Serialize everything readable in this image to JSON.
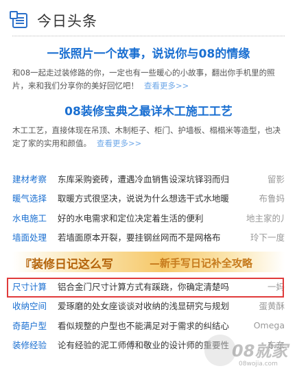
{
  "header": {
    "title": "今日头条"
  },
  "features": [
    {
      "headline": "一张照片一个故事，说说你与08的情缘",
      "desc": "和08一起走过装修路的你，一定也有一些暖心的小故事，翻出你手机里的照片，来和我们分享你的美好回忆吧！",
      "more": "查看更多>>"
    },
    {
      "headline": "08装修宝典之最详木工施工工艺",
      "desc": "木工工艺，直接体现在吊顶、木制柜子、柜门、护墙板、榻榻米等造型，也决定了家的实用和颜值。",
      "more": "查看更多>>"
    }
  ],
  "list_top": [
    {
      "cat": "建材考察",
      "text": "东库采购瓷砖，遭遇冷血销售设深坑铎羽而归",
      "author": "留影"
    },
    {
      "cat": "暖气选择",
      "text": "取暖方式很坚决，说说为什么想选干式水地暖",
      "author": "布鲁妈"
    },
    {
      "cat": "水电施工",
      "text": "好的水电需求和定位决定着生活的便利",
      "author": "地主家的儿子"
    },
    {
      "cat": "墙面处理",
      "text": "若墙面原本开裂，要挂钢丝网而不是网格布",
      "author": "玲下一度"
    }
  ],
  "banner": {
    "main": "装修日记这么写",
    "sub": "—新手写日记补全攻略"
  },
  "list_bottom": [
    {
      "cat": "尺寸计算",
      "text": "铝合金门尺寸计算方式有蹊跷，你确定清楚吗",
      "author": "一妈"
    },
    {
      "cat": "收纳空间",
      "text": "爱琢磨的处女座谈谈对收纳的浅显研究与规划",
      "author": "蛋黄酥"
    },
    {
      "cat": "奇葩户型",
      "text": "看似规整的户型也不能满足对于需求的纠结心",
      "author": "Omega"
    },
    {
      "cat": "装修经验",
      "text": "论有经验的泥工师傅和敬业的设计师的重要性",
      "author": "东东"
    }
  ],
  "watermark": {
    "brand": "08就家",
    "url": "08wojia.com"
  },
  "colors": {
    "link": "#1a6fd1",
    "highlight_border": "#e03a3a",
    "banner_text": "#b4630a"
  }
}
